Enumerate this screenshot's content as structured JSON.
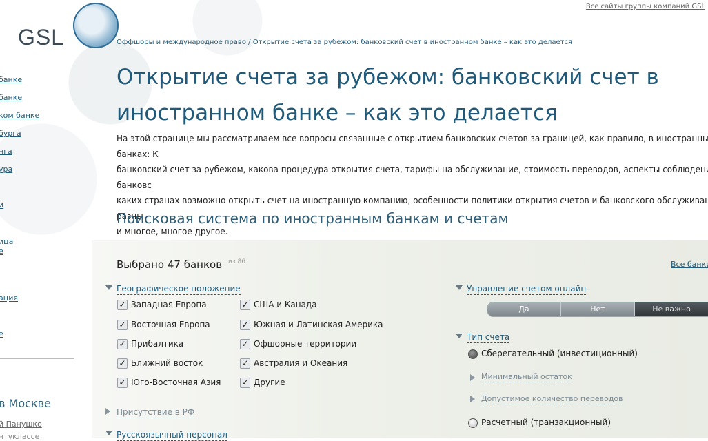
{
  "header": {
    "top_link": "Все сайты группы компаний GSL",
    "logo_text": "GSL"
  },
  "breadcrumb": {
    "parent": "Оффшоры и международное право",
    "separator": "/",
    "current": "Открытие счета за рубежом: банковский счет в иностранном банке – как это делается"
  },
  "sidebar": {
    "items": [
      "банке",
      "банке",
      "ком банке",
      "бурга",
      "нга",
      "ура",
      "и",
      "ица",
      "е",
      "ация",
      "е"
    ],
    "moscow_title": "в Москве",
    "moscow_person": "й Панушко",
    "moscow_extra": "нтуклассе"
  },
  "page": {
    "title": "Открытие счета за рубежом: банковский счет в иностранном банке – как это делается",
    "intro": "На этой странице мы рассматриваем все вопросы связанные с открытием банковских счетов за границей, как правило, в иностранных банках: К\nбанковский счет за рубежом, какова процедура открытия счета, тарифы на обслуживание, стоимость переводов, аспекты соблюдения банковс\nкаких странах возможно открыть счет на иностранную компанию, особенности политики открытия счетов и банковского обслуживания в разны\nи многое, многое другое.",
    "search_heading": "Поисковая система по иностранным банкам и счетам"
  },
  "filters": {
    "selected_label": "Выбрано 47 банков",
    "of_total": "из 86",
    "all_banks_link": "Все банки",
    "geo": {
      "title": "Географическое положение",
      "left": [
        "Западная Европа",
        "Восточная Европа",
        "Прибалтика",
        "Ближний восток",
        "Юго-Восточная Азия"
      ],
      "right": [
        "США и Канада",
        "Южная и Латинская Америка",
        "Офшорные территории",
        "Австралия и Океания",
        "Другие"
      ],
      "check_glyph": "✓"
    },
    "presence": {
      "title": "Присутствие в РФ"
    },
    "russian_staff": {
      "title": "Русскоязычный персонал"
    },
    "online": {
      "title": "Управление счетом онлайн",
      "options": [
        "Да",
        "Нет",
        "Не важно"
      ],
      "selected": "Не важно"
    },
    "account_type": {
      "title": "Тип счета",
      "savings": "Сберегательный (инвестиционный)",
      "min_balance": "Минимальный остаток",
      "transfers": "Допустимое количество переводов",
      "current": "Расчетный (транзакционный)"
    }
  },
  "colors": {
    "link": "#1f5a7a",
    "title": "#1f5a7a",
    "panel_bg": "#eef0ea"
  }
}
